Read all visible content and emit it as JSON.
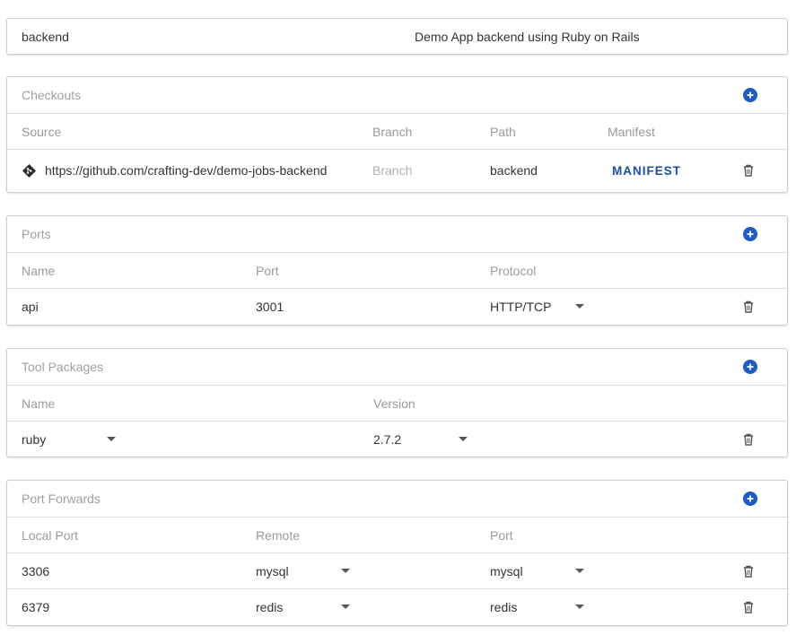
{
  "app": {
    "name": "backend",
    "description": "Demo App backend using Ruby on Rails"
  },
  "checkouts": {
    "title": "Checkouts",
    "columns": [
      "Source",
      "Branch",
      "Path",
      "Manifest"
    ],
    "rows": [
      {
        "source": "https://github.com/crafting-dev/demo-jobs-backend",
        "branch_placeholder": "Branch",
        "path": "backend",
        "manifest_label": "MANIFEST"
      }
    ]
  },
  "ports": {
    "title": "Ports",
    "columns": [
      "Name",
      "Port",
      "Protocol"
    ],
    "rows": [
      {
        "name": "api",
        "port": "3001",
        "protocol": "HTTP/TCP"
      }
    ]
  },
  "tool_packages": {
    "title": "Tool Packages",
    "columns": [
      "Name",
      "Version"
    ],
    "rows": [
      {
        "name": "ruby",
        "version": "2.7.2"
      }
    ]
  },
  "port_forwards": {
    "title": "Port Forwards",
    "columns": [
      "Local Port",
      "Remote",
      "Port"
    ],
    "rows": [
      {
        "local_port": "3306",
        "remote": "mysql",
        "port": "mysql"
      },
      {
        "local_port": "6379",
        "remote": "redis",
        "port": "redis"
      }
    ]
  },
  "colors": {
    "accent": "#1d5bc8",
    "link": "#1a4fa8",
    "border": "#cfcfcf",
    "muted_text": "#9a9a9a"
  },
  "icons": {
    "add": "add-circle-icon",
    "delete": "trash-icon",
    "dropdown": "caret-down-icon",
    "source": "git-icon"
  }
}
